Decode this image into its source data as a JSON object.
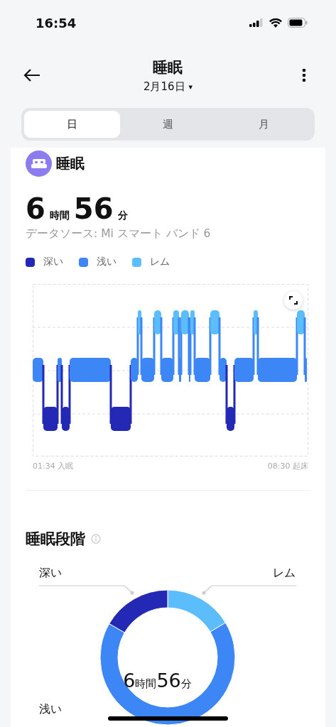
{
  "status_bar": {
    "time": "16:54"
  },
  "header": {
    "title": "睡眠",
    "date": "2月16日",
    "date_caret": "▾"
  },
  "tabs": [
    {
      "label": "日",
      "selected": true
    },
    {
      "label": "週",
      "selected": false
    },
    {
      "label": "月",
      "selected": false
    }
  ],
  "card": {
    "title": "睡眠",
    "duration": {
      "hours": "6",
      "hours_unit": "時間",
      "minutes": "56",
      "minutes_unit": "分"
    },
    "source": "データソース: Mi スマート バンド 6",
    "legend": [
      {
        "label": "深い",
        "color": "#2329b5"
      },
      {
        "label": "浅い",
        "color": "#3d86f5"
      },
      {
        "label": "レム",
        "color": "#5bbdf9"
      }
    ],
    "start_label": "01:34 入眠",
    "end_label": "08:30 起床"
  },
  "stages": {
    "title": "睡眠段階",
    "labels": [
      {
        "label": "深い"
      },
      {
        "label": "レム"
      },
      {
        "label": "浅い"
      }
    ],
    "center": {
      "hours": "6",
      "hours_unit": "時間",
      "minutes": "56",
      "minutes_unit": "分"
    }
  }
}
